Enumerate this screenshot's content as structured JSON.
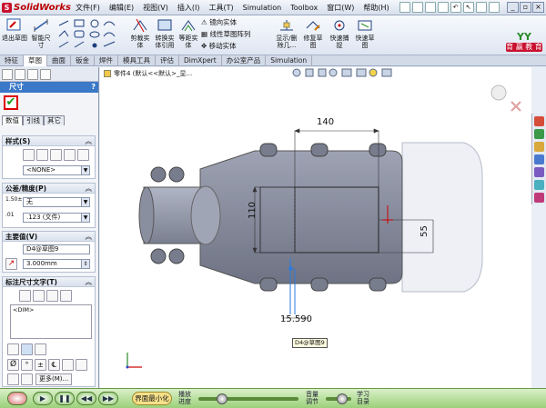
{
  "app": {
    "name": "SolidWorks"
  },
  "menus": [
    "文件(F)",
    "编辑(E)",
    "视图(V)",
    "插入(I)",
    "工具(T)",
    "Simulation",
    "Toolbox",
    "窗口(W)",
    "帮助(H)"
  ],
  "ribbon": {
    "exit_sketch": "退出草图",
    "smart_dim": "智能尺寸",
    "trim": "剪裁实体",
    "convert": "转换实体引用",
    "offset": "等距实体",
    "mirror": "镜向实体",
    "linear_pattern": "线性草图阵列",
    "move": "移动实体",
    "display_delete": "显示/删除几...",
    "repair": "修复草图",
    "quick_snap": "快速捕捉",
    "rapid_sketch": "快速草图"
  },
  "brand": {
    "line1": "YY",
    "line2": "育 赢 教 育"
  },
  "tabs": [
    "特征",
    "草图",
    "曲面",
    "钣金",
    "焊件",
    "模具工具",
    "评估",
    "DimXpert",
    "办公室产品",
    "Simulation"
  ],
  "active_tab": 1,
  "property_manager": {
    "title": "尺寸",
    "help": "?",
    "subtabs": [
      "数值",
      "引线",
      "其它"
    ],
    "style": {
      "title": "样式(S)",
      "value": "<NONE>"
    },
    "tolerance": {
      "title": "公差/精度(P)",
      "tol_value": "无",
      "precision": ".123 (文件)"
    },
    "primary": {
      "title": "主要值(V)",
      "name": "D4@草图9",
      "value": "3.000mm"
    },
    "dim_text": {
      "title": "标注尺寸文字(T)",
      "text": "<DIM>",
      "more": "更多(M)..."
    }
  },
  "viewport": {
    "tree_label": "零件4 (默认<<默认>_显..."
  },
  "drawing": {
    "dim_140": "140",
    "dim_110": "110",
    "dim_55": "55",
    "dim_15590": "15.590",
    "tag": "D4@草图9"
  },
  "player": {
    "minimize": "界面最小化",
    "progress_label": "播放进度",
    "volume_label": "音量调节",
    "list_label": "学习目录"
  },
  "colors": {
    "accent": "#3a78c8",
    "ok": "#1a9a1a",
    "part": "#858a9c"
  }
}
